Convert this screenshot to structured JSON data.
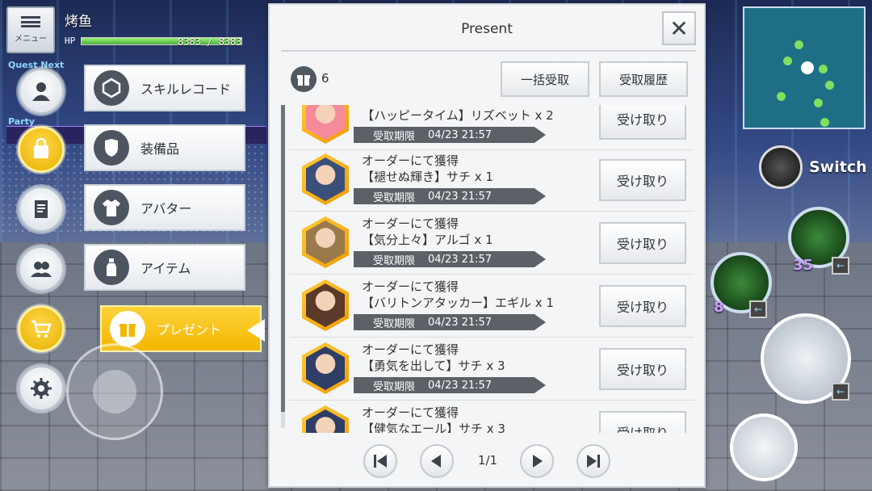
{
  "hud": {
    "menu_label": "メニュー",
    "player_name": "烤鱼",
    "hp_label": "HP",
    "hp_value": "8383 / 8383",
    "hp_fraction": 1.0,
    "quest_label": "Quest Next",
    "party_label": "Party",
    "switch_label": "Switch",
    "skill_counts": [
      "35",
      "8"
    ]
  },
  "menu": {
    "items": [
      {
        "label": "スキルレコード",
        "icon": "skill-record-icon"
      },
      {
        "label": "装備品",
        "icon": "equipment-icon"
      },
      {
        "label": "アバター",
        "icon": "avatar-icon"
      },
      {
        "label": "アイテム",
        "icon": "item-icon"
      },
      {
        "label": "プレゼント",
        "icon": "present-icon"
      }
    ],
    "active": "プレゼント"
  },
  "present": {
    "title": "Present",
    "count": "6",
    "claim_all_label": "一括受取",
    "history_label": "受取履歴",
    "limit_label": "受取期限",
    "receive_label": "受け取り",
    "items": [
      {
        "source": "",
        "item": "【ハッピータイム】リズベット x 2",
        "limit": "04/23 21:57",
        "color": "#f48a9a"
      },
      {
        "source": "オーダーにて獲得",
        "item": "【褪せぬ輝き】サチ x 1",
        "limit": "04/23 21:57",
        "color": "#3a4f7a"
      },
      {
        "source": "オーダーにて獲得",
        "item": "【気分上々】アルゴ x 1",
        "limit": "04/23 21:57",
        "color": "#9a7a4a"
      },
      {
        "source": "オーダーにて獲得",
        "item": "【バリトンアタッカー】エギル x 1",
        "limit": "04/23 21:57",
        "color": "#5a3a28"
      },
      {
        "source": "オーダーにて獲得",
        "item": "【勇気を出して】サチ x 3",
        "limit": "04/23 21:57",
        "color": "#2e3e66"
      },
      {
        "source": "オーダーにて獲得",
        "item": "【健気なエール】サチ x 3",
        "limit": "",
        "color": "#2e3e66"
      }
    ],
    "page": "1/1"
  }
}
